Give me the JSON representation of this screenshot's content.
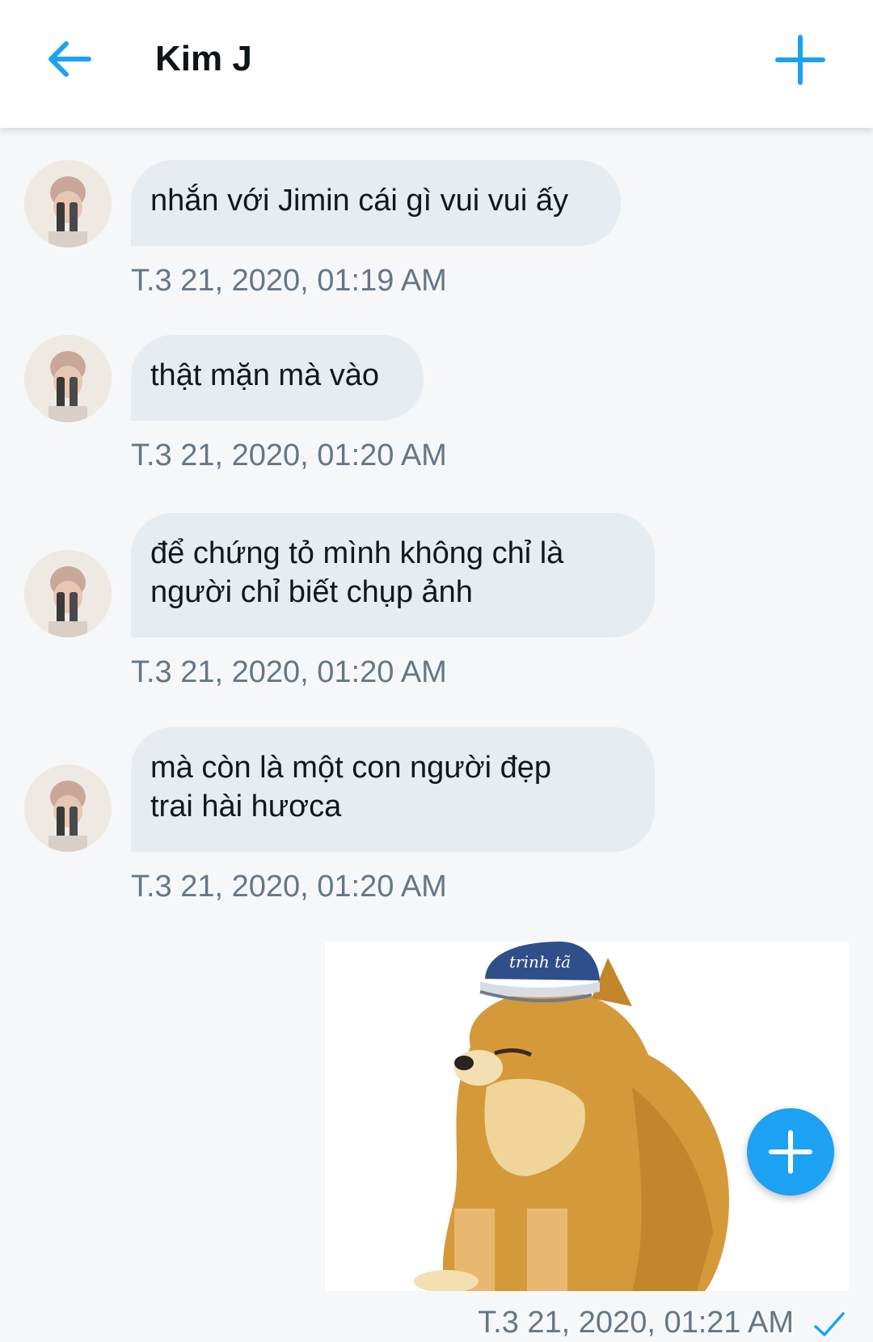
{
  "header": {
    "title": "Kim J",
    "back_icon": "arrow-left-icon",
    "compose_icon": "plus-icon"
  },
  "messages": [
    {
      "text": "nhắn với Jimin cái gì vui vui ấy",
      "time": "T.3 21, 2020, 01:19 AM"
    },
    {
      "text": "thật mặn mà vào",
      "time": "T.3 21, 2020, 01:20 AM"
    },
    {
      "text_line1": "để chứng tỏ mình không chỉ là",
      "text_line2": "người chỉ biết chụp ảnh",
      "time": "T.3 21, 2020, 01:20 AM"
    },
    {
      "text_line1": "mà còn là một con người đẹp",
      "text_line2": "trai hài hươca",
      "time": "T.3 21, 2020, 01:20 AM"
    }
  ],
  "sent_image": {
    "hat_text": "trinh tã",
    "time": "T.3 21, 2020, 01:21 AM",
    "status_icon": "check-icon"
  },
  "fab": {
    "icon": "plus-icon"
  },
  "colors": {
    "accent": "#1da1f2",
    "bubble": "#e6ecf0",
    "timestamp": "#657786"
  }
}
